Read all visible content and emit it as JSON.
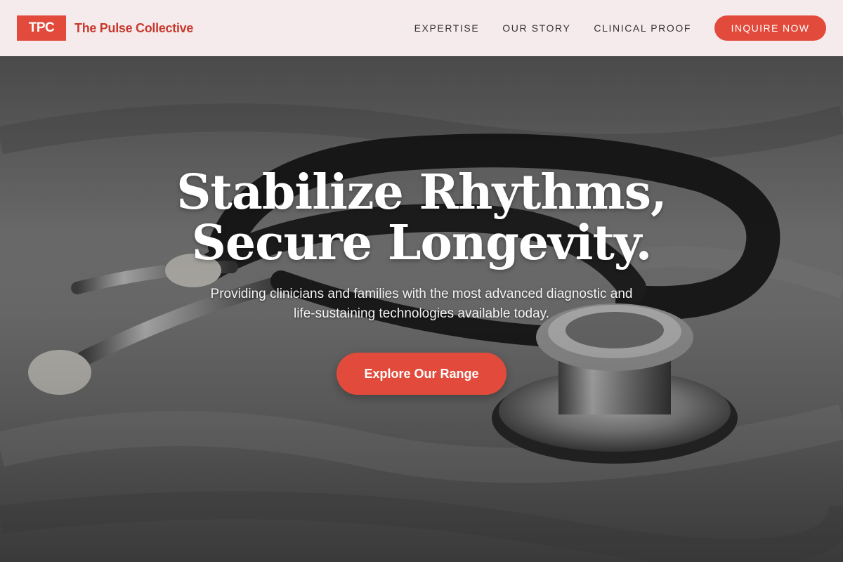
{
  "brand": {
    "badge": "TPC",
    "name": "The Pulse Collective"
  },
  "nav": {
    "links": [
      "EXPERTISE",
      "OUR STORY",
      "CLINICAL PROOF"
    ],
    "cta_label": "INQUIRE NOW"
  },
  "hero": {
    "title_line1": "Stabilize Rhythms,",
    "title_line2": "Secure Longevity.",
    "subtitle_line1": "Providing clinicians and families with the most advanced diagnostic and",
    "subtitle_line2": "life-sustaining technologies available today.",
    "cta_label": "Explore Our Range",
    "background_image": "stethoscope-photo"
  },
  "colors": {
    "accent": "#e24b3c",
    "brand_text": "#c83a2e",
    "header_bg": "#f6ebec",
    "nav_text": "#333333"
  }
}
